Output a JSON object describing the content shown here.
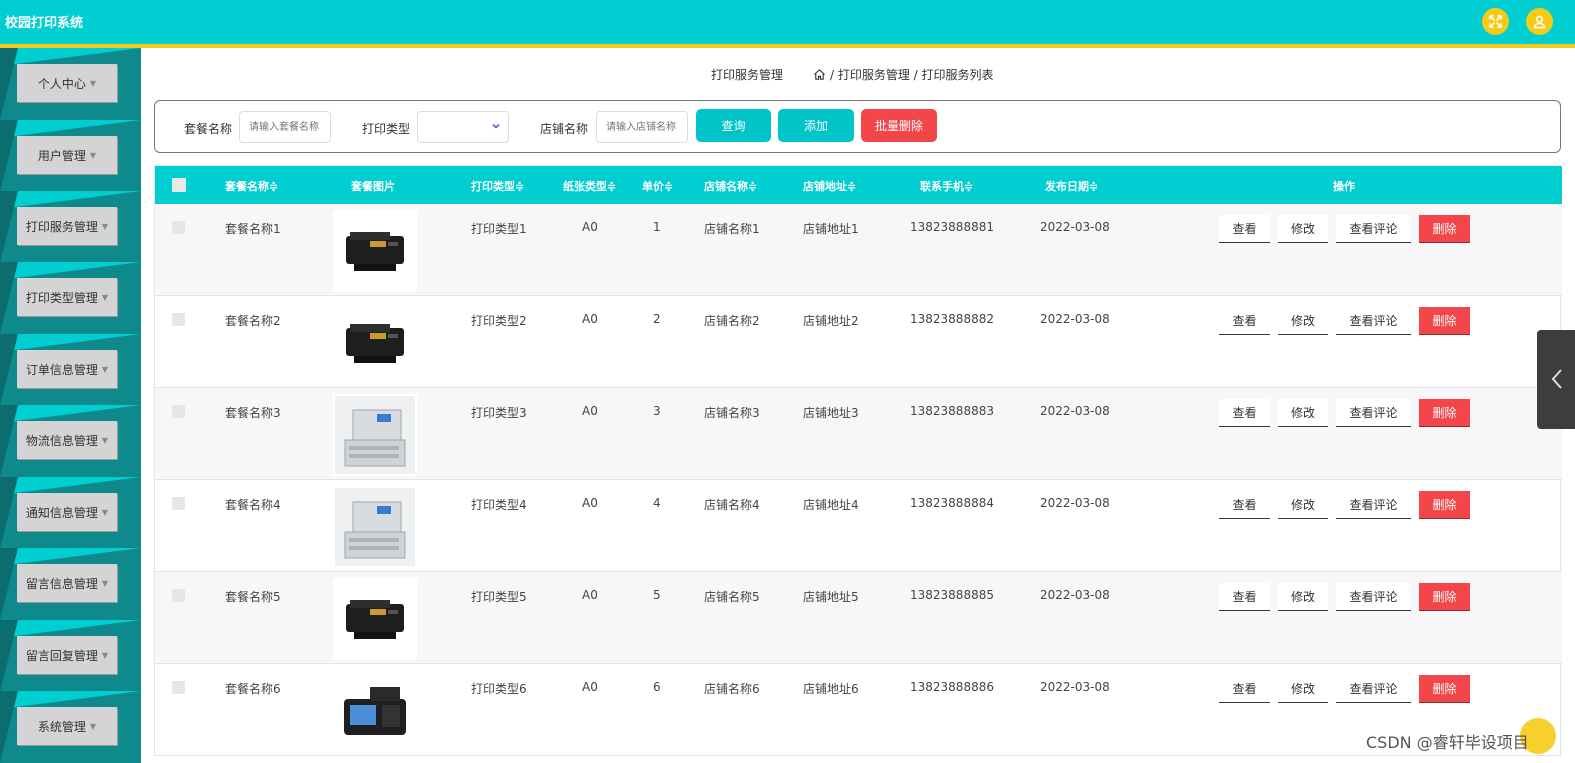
{
  "app": {
    "title": "校园打印系统"
  },
  "topbar": {
    "icons": [
      "fullscreen-icon",
      "user-icon"
    ],
    "accent": "#00ced1",
    "stripe": "#f3c91a"
  },
  "sidebar": {
    "items": [
      {
        "label": "个人中心"
      },
      {
        "label": "用户管理"
      },
      {
        "label": "打印服务管理"
      },
      {
        "label": "打印类型管理"
      },
      {
        "label": "订单信息管理"
      },
      {
        "label": "物流信息管理"
      },
      {
        "label": "通知信息管理"
      },
      {
        "label": "留言信息管理"
      },
      {
        "label": "留言回复管理"
      },
      {
        "label": "系统管理"
      }
    ]
  },
  "page": {
    "title": "打印服务管理",
    "breadcrumb": "/ 打印服务管理 / 打印服务列表"
  },
  "search": {
    "package_label": "套餐名称",
    "package_placeholder": "请输入套餐名称",
    "type_label": "打印类型",
    "type_value": "",
    "shop_label": "店铺名称",
    "shop_placeholder": "请输入店铺名称",
    "query_button": "查询",
    "add_button": "添加",
    "batch_delete_button": "批量删除"
  },
  "table": {
    "headers": {
      "name": "套餐名称",
      "image": "套餐图片",
      "type": "打印类型",
      "paper": "纸张类型",
      "price": "单价",
      "shop": "店铺名称",
      "address": "店铺地址",
      "phone": "联系手机",
      "date": "发布日期",
      "actions": "操作"
    },
    "sort_mark": "≑",
    "action_labels": {
      "view": "查看",
      "edit": "修改",
      "reviews": "查看评论",
      "delete": "删除"
    },
    "rows": [
      {
        "name": "套餐名称1",
        "image": "laser-printer-image",
        "type": "打印类型1",
        "paper": "A0",
        "price": "1",
        "shop": "店铺名称1",
        "address": "店铺地址1",
        "phone": "13823888881",
        "date": "2022-03-08"
      },
      {
        "name": "套餐名称2",
        "image": "laser-printer-image",
        "type": "打印类型2",
        "paper": "A0",
        "price": "2",
        "shop": "店铺名称2",
        "address": "店铺地址2",
        "phone": "13823888882",
        "date": "2022-03-08"
      },
      {
        "name": "套餐名称3",
        "image": "copier-image",
        "type": "打印类型3",
        "paper": "A0",
        "price": "3",
        "shop": "店铺名称3",
        "address": "店铺地址3",
        "phone": "13823888883",
        "date": "2022-03-08"
      },
      {
        "name": "套餐名称4",
        "image": "copier-image",
        "type": "打印类型4",
        "paper": "A0",
        "price": "4",
        "shop": "店铺名称4",
        "address": "店铺地址4",
        "phone": "13823888884",
        "date": "2022-03-08"
      },
      {
        "name": "套餐名称5",
        "image": "laser-printer-image",
        "type": "打印类型5",
        "paper": "A0",
        "price": "5",
        "shop": "店铺名称5",
        "address": "店铺地址5",
        "phone": "13823888885",
        "date": "2022-03-08"
      },
      {
        "name": "套餐名称6",
        "image": "pos-terminal-image",
        "type": "打印类型6",
        "paper": "A0",
        "price": "6",
        "shop": "店铺名称6",
        "address": "店铺地址6",
        "phone": "13823888886",
        "date": "2022-03-08"
      }
    ]
  },
  "watermark": "CSDN @睿轩毕设项目"
}
